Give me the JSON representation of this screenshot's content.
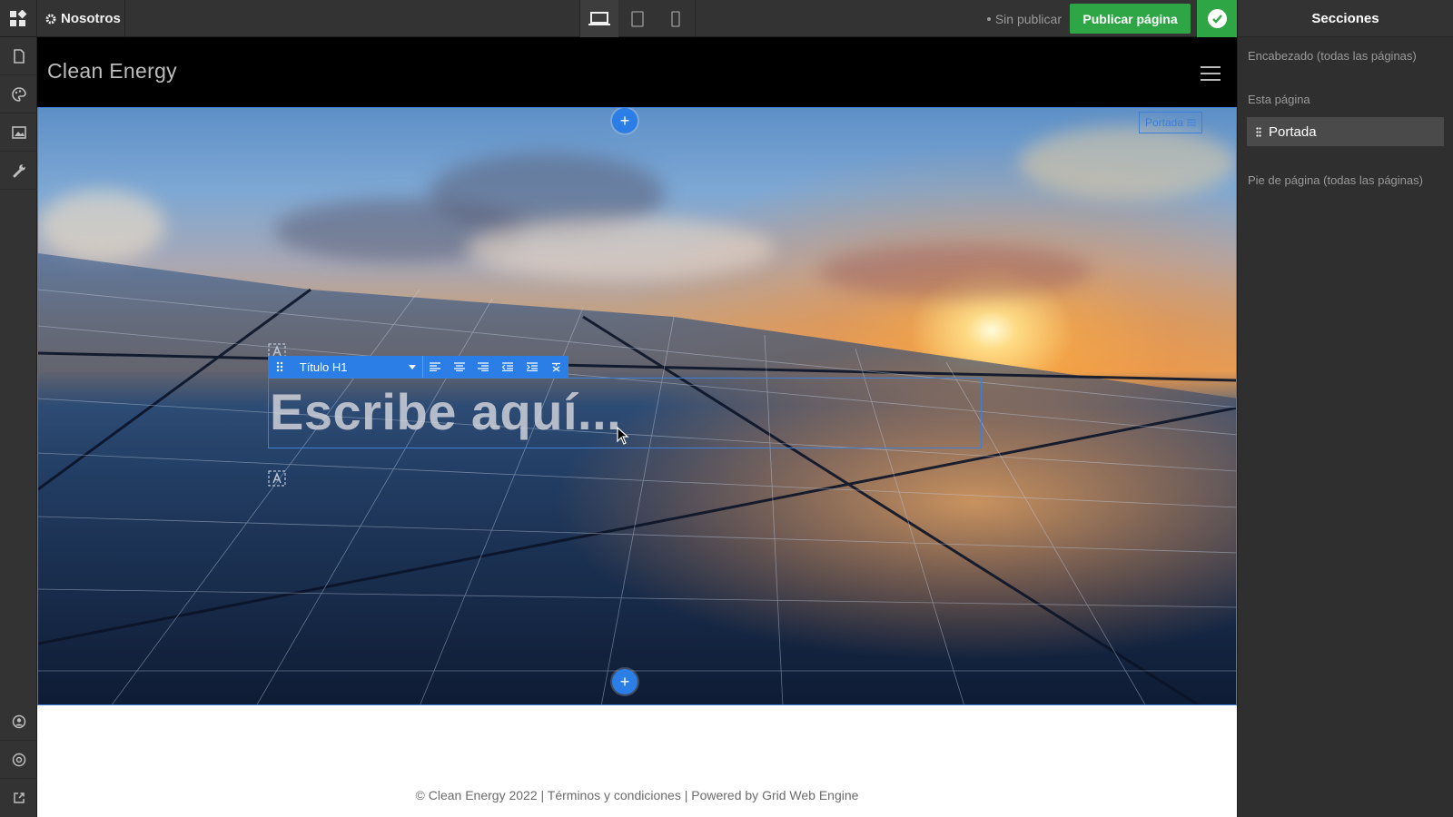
{
  "topbar": {
    "page_name": "Nosotros",
    "status": "Sin publicar",
    "publish_label": "Publicar página"
  },
  "site": {
    "title": "Clean Energy",
    "footer": "© Clean Energy 2022 | Términos y condiciones | Powered by Grid Web Engine"
  },
  "hero": {
    "section_label": "Portada",
    "placeholder": "Escribe aquí...",
    "style_option": "Título H1"
  },
  "sections_panel": {
    "title": "Secciones",
    "header_label": "Encabezado (todas las páginas)",
    "this_page_label": "Esta página",
    "items": [
      "Portada"
    ],
    "footer_label": "Pie de página (todas las páginas)"
  },
  "colors": {
    "accent": "#2a7ee6",
    "publish": "#2ea645",
    "chrome": "#333333"
  }
}
